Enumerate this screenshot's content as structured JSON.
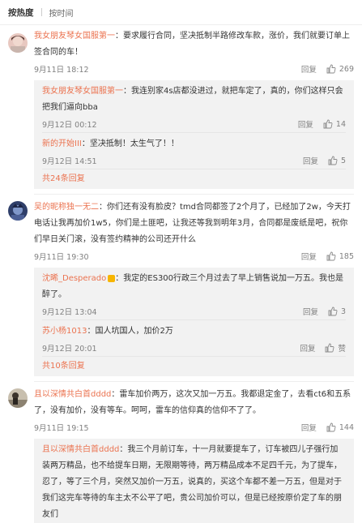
{
  "sort": {
    "hot": "按热度",
    "time": "按时间"
  },
  "comments": [
    {
      "name": "我女朋友琴女国服第一",
      "text": "：要求履行合同，坚决抵制半路修改车款，涨价，我们就要订单上签合同的车！",
      "time": "9月11日 18:12",
      "reply": "回复",
      "likes": "269",
      "replies": [
        {
          "name": "我女朋友琴女国服第一",
          "text": "：我连别家4s店都没进过，就把车定了，真的，你们这样只会把我们逼向bba",
          "time": "9月12日 00:12",
          "reply": "回复",
          "likes": "14"
        },
        {
          "name": "新的开始III",
          "text": "：坚决抵制！太生气了！！",
          "time": "9月12日 14:51",
          "reply": "回复",
          "likes": "5"
        }
      ],
      "more": "共24条回复"
    },
    {
      "name": "吴的昵称独一无二",
      "text": "：你们还有没有脸皮？tmd合同都签了2个月了，已经加了2w，今天打电话让我再加价1w5，你们是土匪吧，让我还等我到明年3月，合同都是废纸是吧，祝你们早日关门滚，没有签约精神的公司还开什么",
      "time": "9月11日 19:30",
      "reply": "回复",
      "likes": "185",
      "replies": [
        {
          "name": "沈晞_Desperado",
          "text": "：我定的ES300行政三个月过去了早上销售说加一万五。我也是醉了。",
          "time": "9月12日 13:04",
          "reply": "回复",
          "likes": "3"
        },
        {
          "name": "苏小杨1013",
          "text": "：国人坑国人，加价2万",
          "time": "9月12日 20:01",
          "reply": "回复",
          "likes": "赞"
        }
      ],
      "more": "共10条回复"
    },
    {
      "name": "且以深情共白首dddd",
      "text": "：雷车加价两万，这次又加一万五。我都退定金了，去看ct6和五系了，没有加价，没有等车。呵呵，雷车的信仰真的信仰不了了。",
      "time": "9月11日 19:15",
      "reply": "回复",
      "likes": "144",
      "replies": [
        {
          "name": "且以深情共白首dddd",
          "text": "：我三个月前订车，十一月就要提车了，订车被四儿子强行加装两万精品，也不给提车日期，无限期等待，两万精品成本不足四千元，为了提车，忍了，等了三个月，突然又加价一万五，说真的，买这个车都不差一万五，但是对于我们这完车等待的车主太不公平了吧，贵公司加价可以，但是已经按原价定了车的朋友们",
          "time": "",
          "reply": "",
          "likes": ""
        }
      ],
      "more": ""
    }
  ]
}
